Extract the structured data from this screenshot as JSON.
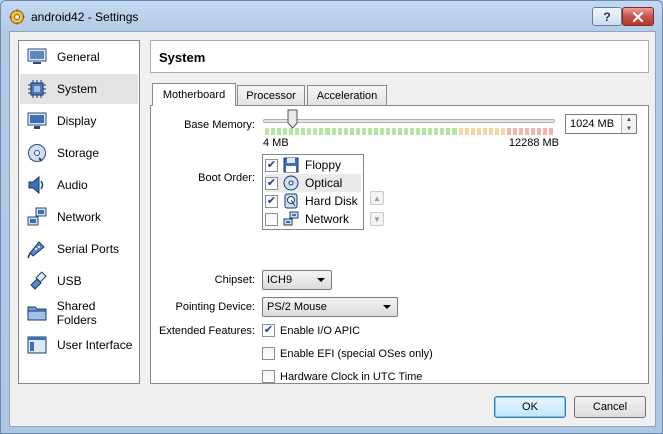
{
  "window": {
    "title": "android42 - Settings",
    "help_label": "?"
  },
  "sidebar": {
    "items": [
      {
        "label": "General",
        "icon": "general-icon"
      },
      {
        "label": "System",
        "icon": "system-chip-icon"
      },
      {
        "label": "Display",
        "icon": "monitor-icon"
      },
      {
        "label": "Storage",
        "icon": "disk-icon"
      },
      {
        "label": "Audio",
        "icon": "speaker-icon"
      },
      {
        "label": "Network",
        "icon": "network-icon"
      },
      {
        "label": "Serial Ports",
        "icon": "serial-port-icon"
      },
      {
        "label": "USB",
        "icon": "usb-icon"
      },
      {
        "label": "Shared Folders",
        "icon": "folder-icon"
      },
      {
        "label": "User Interface",
        "icon": "user-interface-icon"
      }
    ],
    "selected_index": 1
  },
  "page": {
    "title": "System"
  },
  "tabs": [
    {
      "label": "Motherboard",
      "active": true
    },
    {
      "label": "Processor",
      "active": false
    },
    {
      "label": "Acceleration",
      "active": false
    }
  ],
  "motherboard": {
    "base_memory": {
      "label": "Base Memory:",
      "value": "1024 MB",
      "min_label": "4 MB",
      "max_label": "12288 MB",
      "fraction": 0.083
    },
    "boot_order": {
      "label": "Boot Order:",
      "items": [
        {
          "label": "Floppy",
          "checked": true,
          "icon": "floppy-icon"
        },
        {
          "label": "Optical",
          "checked": true,
          "icon": "optical-disc-icon"
        },
        {
          "label": "Hard Disk",
          "checked": true,
          "icon": "hard-disk-icon"
        },
        {
          "label": "Network",
          "checked": false,
          "icon": "network-icon"
        }
      ],
      "move_up_icon": "arrow-up-icon",
      "move_down_icon": "arrow-down-icon"
    },
    "chipset": {
      "label": "Chipset:",
      "value": "ICH9"
    },
    "pointing_device": {
      "label": "Pointing Device:",
      "value": "PS/2 Mouse"
    },
    "extended_features": {
      "label": "Extended Features:",
      "items": [
        {
          "label": "Enable I/O APIC",
          "checked": true
        },
        {
          "label": "Enable EFI (special OSes only)",
          "checked": false
        },
        {
          "label": "Hardware Clock in UTC Time",
          "checked": false
        }
      ]
    }
  },
  "buttons": {
    "ok": "OK",
    "cancel": "Cancel"
  },
  "colors": {
    "slider_green": "#b5e6a2",
    "slider_orange": "#f7d7a0",
    "slider_red": "#f4b6b0"
  }
}
